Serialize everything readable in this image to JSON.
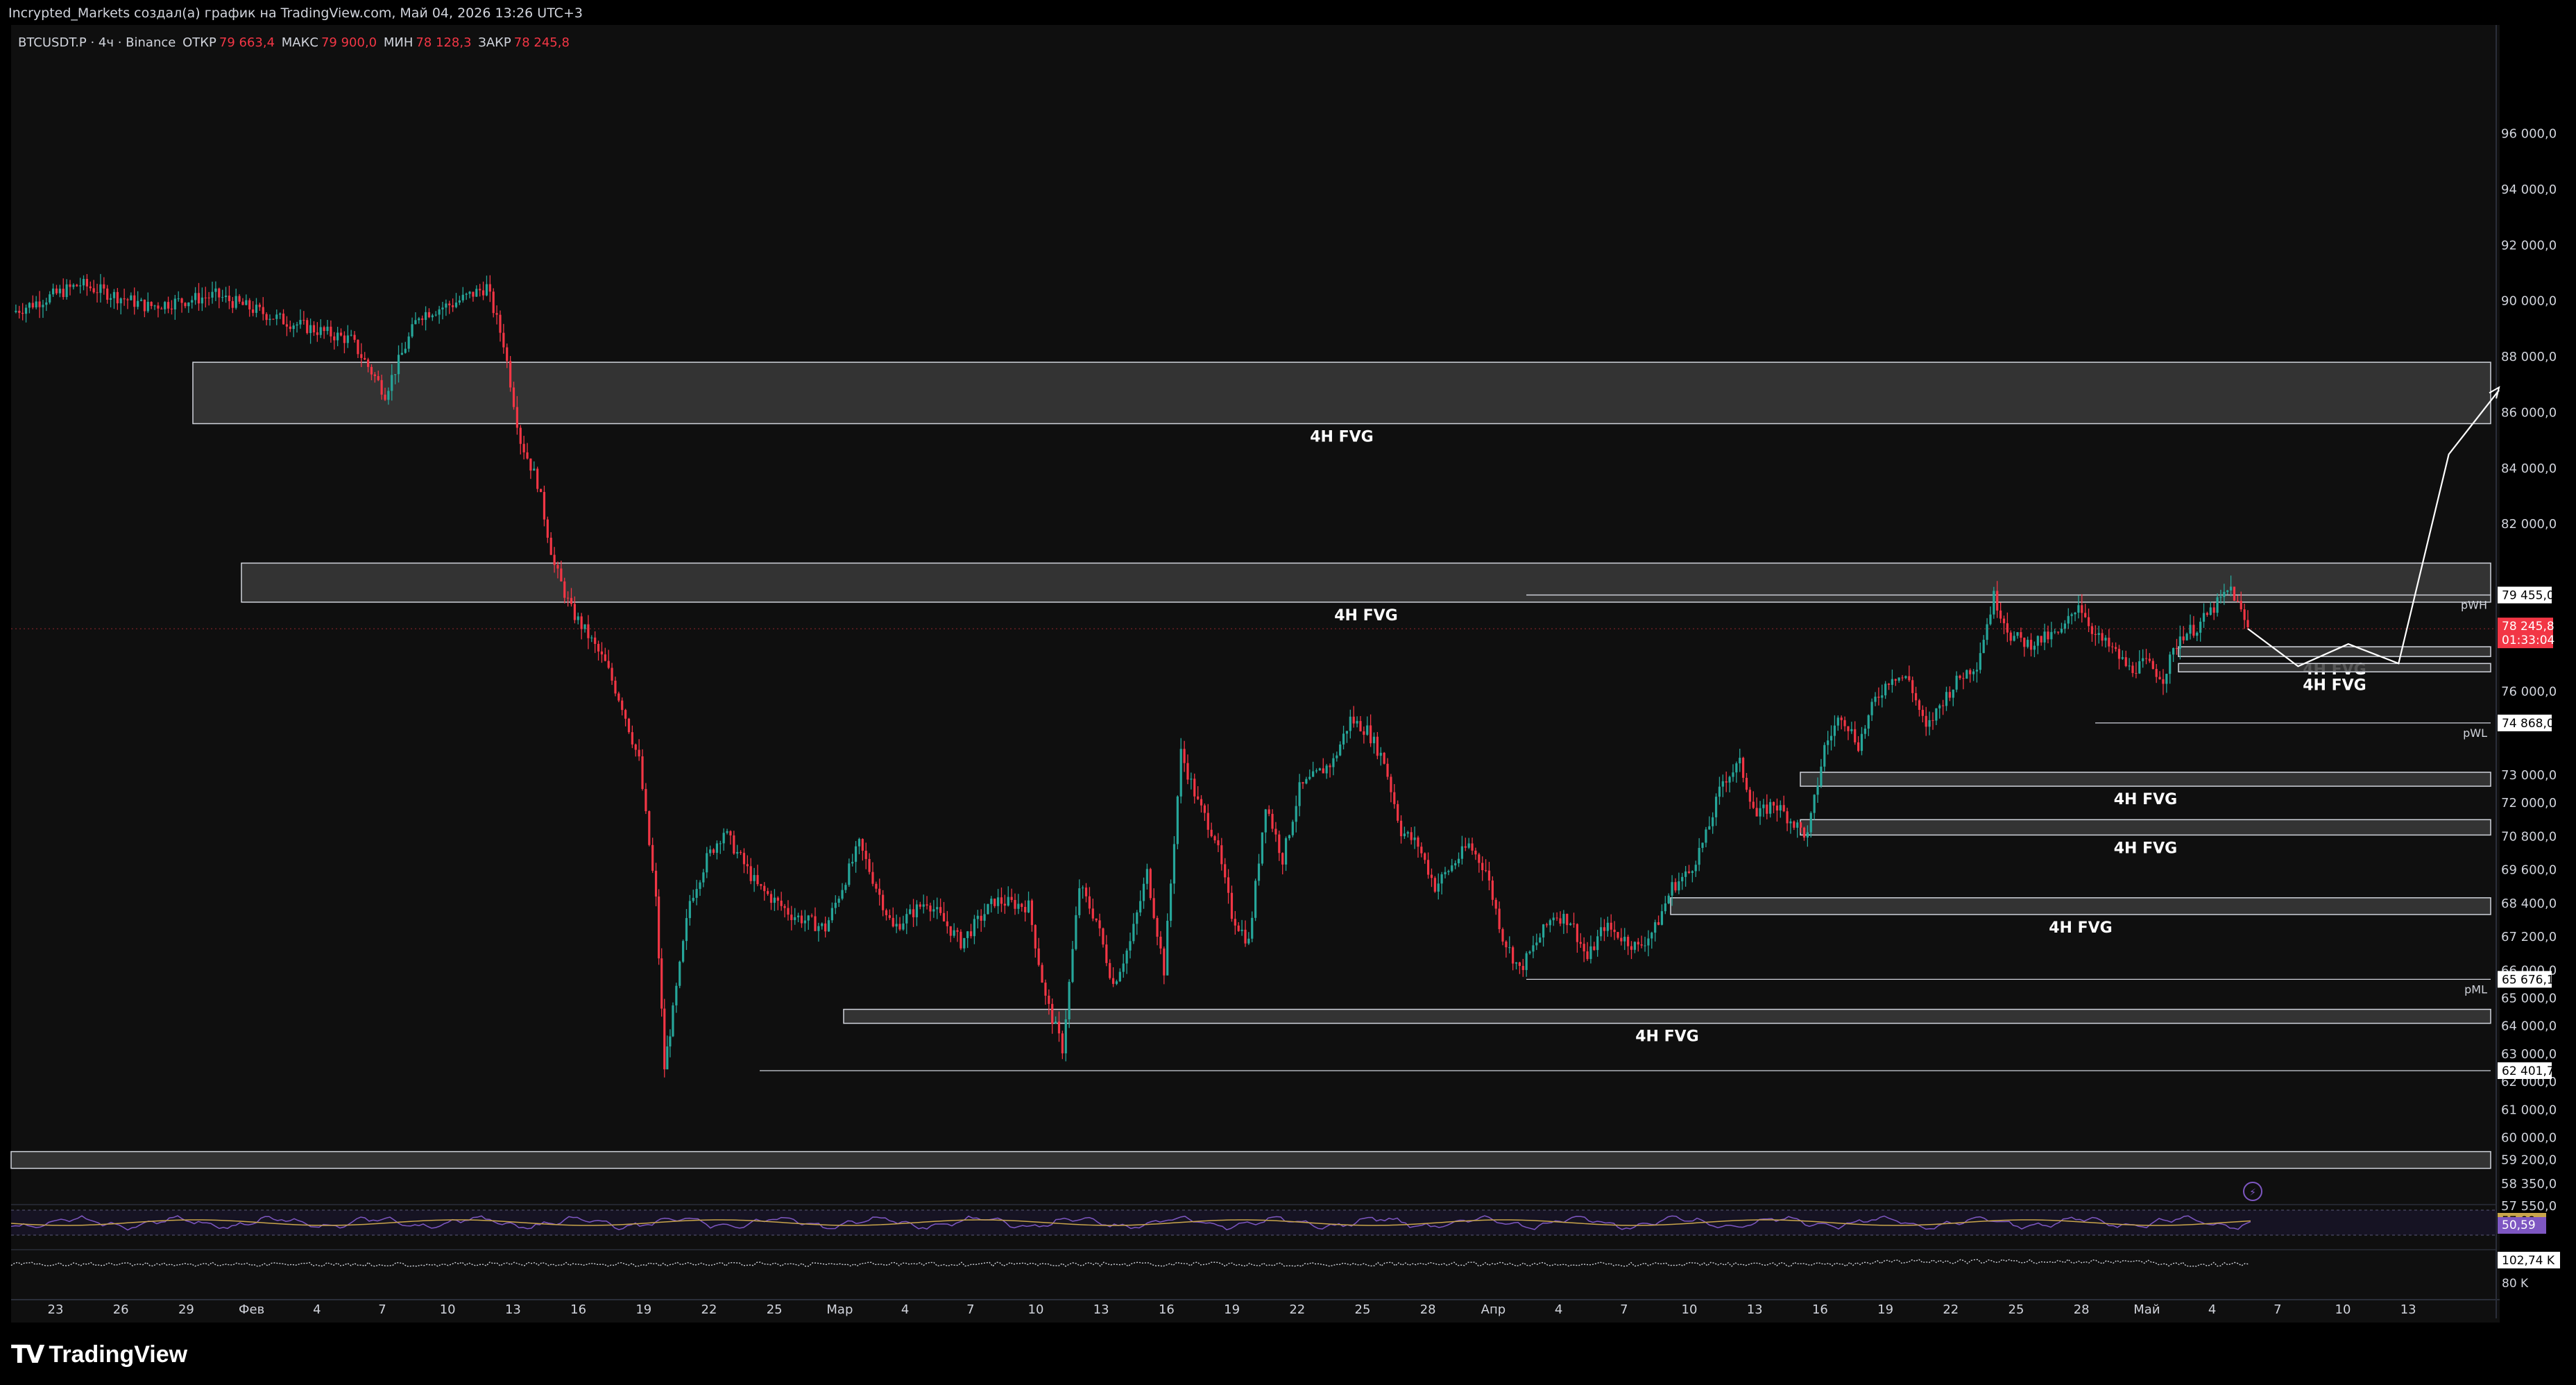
{
  "caption": "Incrypted_Markets создал(а) график на TradingView.com, Май 04, 2026 13:26 UTC+3",
  "header": {
    "symbol": "BTCUSDT.P · 4ч · Binance",
    "open_label": "ОТКР",
    "open_value": "79 663,4",
    "high_label": "МАКС",
    "high_value": "79 900,0",
    "low_label": "МИН",
    "low_value": "78 128,3",
    "close_label": "ЗАКР",
    "close_value": "78 245,8"
  },
  "brand": "TradingView",
  "colors": {
    "up": "#26a69a",
    "down": "#f23645",
    "bg": "#0f0f0f",
    "zone_fill": "#3a3a3a",
    "zone_border": "#d1d4dc",
    "rsi": "#7e57c2",
    "rsi_ma": "#c9a54b"
  },
  "chart_data": {
    "type": "candlestick",
    "symbol": "BTCUSDT.P",
    "interval": "4ч",
    "exchange": "Binance",
    "ylim": [
      57500,
      98500
    ],
    "y_ticks": [
      "96 000,0",
      "94 000,0",
      "92 000,0",
      "90 000,0",
      "88 000,0",
      "86 000,0",
      "84 000,0",
      "82 000,0",
      "76 000,0",
      "73 000,0",
      "72 000,0",
      "70 800,0",
      "69 600,0",
      "68 400,0",
      "67 200,0",
      "66 000,0",
      "65 000,0",
      "64 000,0",
      "63 000,0",
      "62 000,0",
      "61 000,0",
      "60 000,0",
      "59 200,0",
      "58 350,0",
      "57 550,0"
    ],
    "x_ticks": [
      "23",
      "26",
      "29",
      "Фев",
      "4",
      "7",
      "10",
      "13",
      "16",
      "19",
      "22",
      "25",
      "Мар",
      "4",
      "7",
      "10",
      "13",
      "16",
      "19",
      "22",
      "25",
      "28",
      "Апр",
      "4",
      "7",
      "10",
      "13",
      "16",
      "19",
      "22",
      "25",
      "28",
      "Май",
      "4",
      "7",
      "10",
      "13"
    ],
    "price_path": [
      [
        0,
        89600
      ],
      [
        4,
        90600
      ],
      [
        8,
        89800
      ],
      [
        12,
        90200
      ],
      [
        16,
        89300
      ],
      [
        20,
        88600
      ],
      [
        22,
        86700
      ],
      [
        24,
        89500
      ],
      [
        26,
        89900
      ],
      [
        28,
        90500
      ],
      [
        29,
        88500
      ],
      [
        30,
        85000
      ],
      [
        31,
        83500
      ],
      [
        32,
        80500
      ],
      [
        33,
        78900
      ],
      [
        34,
        78000
      ],
      [
        35,
        77000
      ],
      [
        36,
        75500
      ],
      [
        37,
        73500
      ],
      [
        38,
        68500
      ],
      [
        38.5,
        62500
      ],
      [
        39,
        64500
      ],
      [
        40,
        68500
      ],
      [
        41,
        70000
      ],
      [
        42,
        71000
      ],
      [
        44,
        69000
      ],
      [
        46,
        68000
      ],
      [
        48,
        67500
      ],
      [
        50,
        70500
      ],
      [
        52,
        67500
      ],
      [
        54,
        68500
      ],
      [
        56,
        67000
      ],
      [
        58,
        68500
      ],
      [
        60,
        68300
      ],
      [
        61,
        65000
      ],
      [
        62,
        63200
      ],
      [
        63,
        69000
      ],
      [
        64,
        67800
      ],
      [
        65,
        65500
      ],
      [
        66,
        67000
      ],
      [
        67,
        69500
      ],
      [
        68,
        66000
      ],
      [
        69,
        73800
      ],
      [
        70,
        72000
      ],
      [
        71,
        70800
      ],
      [
        72,
        68000
      ],
      [
        73,
        67000
      ],
      [
        74,
        72000
      ],
      [
        75,
        70000
      ],
      [
        76,
        72500
      ],
      [
        78,
        73500
      ],
      [
        79,
        75000
      ],
      [
        80,
        74600
      ],
      [
        81,
        73500
      ],
      [
        82,
        71000
      ],
      [
        83,
        70500
      ],
      [
        84,
        69000
      ],
      [
        86,
        70500
      ],
      [
        87,
        69600
      ],
      [
        88,
        67200
      ],
      [
        89,
        66000
      ],
      [
        90,
        67000
      ],
      [
        91,
        68000
      ],
      [
        92,
        67800
      ],
      [
        93,
        66400
      ],
      [
        94,
        67600
      ],
      [
        96,
        66800
      ],
      [
        97,
        67500
      ],
      [
        98,
        69000
      ],
      [
        99,
        69500
      ],
      [
        100,
        70800
      ],
      [
        101,
        72800
      ],
      [
        102,
        73400
      ],
      [
        103,
        71500
      ],
      [
        104,
        72000
      ],
      [
        106,
        70800
      ],
      [
        107,
        74000
      ],
      [
        108,
        75200
      ],
      [
        109,
        74100
      ],
      [
        110,
        75700
      ],
      [
        111,
        76600
      ],
      [
        112,
        76400
      ],
      [
        113,
        74600
      ],
      [
        114,
        75700
      ],
      [
        115,
        76500
      ],
      [
        116,
        77000
      ],
      [
        117,
        79400
      ],
      [
        118,
        78000
      ],
      [
        119,
        77700
      ],
      [
        120,
        77900
      ],
      [
        121,
        78100
      ],
      [
        122,
        79200
      ],
      [
        123,
        78000
      ],
      [
        124,
        77500
      ],
      [
        125,
        76800
      ],
      [
        126,
        77000
      ],
      [
        127,
        76500
      ],
      [
        128,
        78000
      ],
      [
        129,
        78300
      ],
      [
        130,
        79000
      ],
      [
        131,
        79700
      ],
      [
        132,
        78246
      ]
    ],
    "fvg_zones": [
      {
        "label": "4H FVG",
        "top": 87800,
        "bottom": 85600,
        "from": "29",
        "to": "end"
      },
      {
        "label": "4H FVG",
        "top": 80600,
        "bottom": 79200,
        "from": "Фев",
        "to": "end"
      },
      {
        "label": "4H FVG",
        "top": 77600,
        "bottom": 77250,
        "from": "Май",
        "to": "end"
      },
      {
        "label": "4H FVG",
        "top": 77000,
        "bottom": 76700,
        "from": "Май",
        "to": "end"
      },
      {
        "label": "4H FVG",
        "top": 73100,
        "bottom": 72600,
        "from": "13",
        "to": "end"
      },
      {
        "label": "4H FVG",
        "top": 71400,
        "bottom": 70850,
        "from": "13",
        "to": "end"
      },
      {
        "label": "4H FVG",
        "top": 68600,
        "bottom": 68000,
        "from": "7",
        "to": "end"
      },
      {
        "label": "4H FVG",
        "top": 64600,
        "bottom": 64100,
        "from": "Мар",
        "to": "end"
      },
      {
        "label": "",
        "top": 59500,
        "bottom": 58900,
        "from": "start",
        "to": "end"
      }
    ],
    "levels": [
      {
        "label": "pWH",
        "price": 79455.0,
        "tag": "79 455,0"
      },
      {
        "label": "",
        "price": 79455.0,
        "tag": "79 455,0"
      },
      {
        "label": "pWL",
        "price": 74868.0,
        "tag": "74 868,0"
      },
      {
        "label": "pML",
        "price": 65676.1,
        "tag": "65 676,1"
      },
      {
        "label": "",
        "price": 62401.7,
        "tag": "62 401,7"
      }
    ],
    "last_price": {
      "value": "78 245,8",
      "countdown": "01:33:04"
    },
    "projection": [
      [
        132,
        78246
      ],
      [
        133,
        76900
      ],
      [
        134,
        77700
      ],
      [
        135,
        77000
      ],
      [
        136,
        84500
      ],
      [
        137,
        86800
      ]
    ],
    "rsi": {
      "value": "50,59",
      "upper": "57,09"
    },
    "volume": {
      "value": "102,74 K",
      "scale": "80 K"
    }
  }
}
